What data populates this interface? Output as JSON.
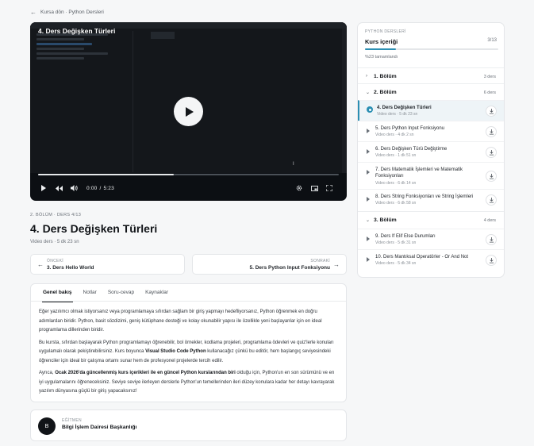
{
  "back": {
    "label": "Kursa dön · Python Dersleri"
  },
  "video": {
    "title": "4. Ders Değişken Türleri",
    "progress": 0.45,
    "time_current": "0:00",
    "time_total": "5:23"
  },
  "lesson": {
    "breadcrumb": "2. BÖLÜM · DERS 4/13",
    "title": "4. Ders Değişken Türleri",
    "meta": "Video ders · 5 dk 23 sn"
  },
  "nav": {
    "prev_label": "ÖNCEKİ",
    "prev_title": "3. Ders Hello World",
    "next_label": "SONRAKİ",
    "next_title": "5. Ders Python Input Fonksiyonu"
  },
  "tabs": [
    "Genel bakış",
    "Notlar",
    "Soru-cevap",
    "Kaynaklar"
  ],
  "overview": {
    "p1": "Eğer yazılımcı olmak istiyorsanız veya programlamaya sıfırdan sağlam bir giriş yapmayı hedefliyorsanız, Python öğrenmek en doğru adımlardan biridir. Python, basit sözdizimi, geniş kütüphane desteği ve kolay okunabilir yapısı ile özellikle yeni başlayanlar için en ideal programlama dillerinden biridir.",
    "p2a": "Bu kursta, sıfırdan başlayarak Python programlamayı öğrenebilir, bol örnekler, kodlama projeleri, programlama ödevleri ve quiz'lerle konuları uygulamalı olarak pekiştirebilirsiniz. Kurs boyunca ",
    "p2b": "Visual Studio Code Python",
    "p2c": " kullanacağız çünkü bu editör, hem başlangıç seviyesindeki öğrenciler için ideal bir çalışma ortamı sunar hem de profesyonel projelerde tercih edilir.",
    "p3a": "Ayrıca, ",
    "p3b": "Ocak 2026'da güncellenmiş kurs içerikleri ile en güncel Python kurslarından biri",
    "p3c": " olduğu için, Python'un en son sürümünü ve en iyi uygulamalarını öğreneceksiniz. Seviye seviye ilerleyen derslerle Python'un temellerinden ileri düzey konulara kadar her detayı kavrayarak yazılım dünyasına güçlü bir giriş yapacaksınız!"
  },
  "instructor": {
    "label": "EĞİTMEN",
    "initial": "B",
    "name": "Bilgi İşlem Dairesi Başkanlığı"
  },
  "sidebar": {
    "course": "PYTHON DERSLERİ",
    "title": "Kurs içeriği",
    "count": "3/13",
    "progress": 0.23,
    "percent": "%23 tamamlandı",
    "sections": [
      {
        "name": "1. Bölüm",
        "count": "3 ders"
      },
      {
        "name": "2. Bölüm",
        "count": "6 ders"
      },
      {
        "name": "3. Bölüm",
        "count": "4 ders"
      }
    ],
    "lessons": [
      {
        "title": "4. Ders Değişken Türleri",
        "meta": "Video ders · 5 dk 23 sn"
      },
      {
        "title": "5. Ders Python Input Fonksiyonu",
        "meta": "Video ders · 4 dk 2 sn"
      },
      {
        "title": "6. Ders Değişken Türü Değiştirme",
        "meta": "Video ders · 1 dk 51 sn"
      },
      {
        "title": "7. Ders Matematik İşlemleri ve Matematik Fonksiyonları",
        "meta": "Video ders · 6 dk 14 sn"
      },
      {
        "title": "8. Ders String Fonksiyonları ve String İşlemleri",
        "meta": "Video ders · 6 dk 58 sn"
      },
      {
        "title": "9. Ders If Elif Else Durumları",
        "meta": "Video ders · 5 dk 31 sn"
      },
      {
        "title": "10. Ders Mantıksal Operatörler - Or And Not",
        "meta": "Video ders · 5 dk 34 sn"
      }
    ]
  },
  "colors": {
    "accent": "#2b8fb3"
  }
}
